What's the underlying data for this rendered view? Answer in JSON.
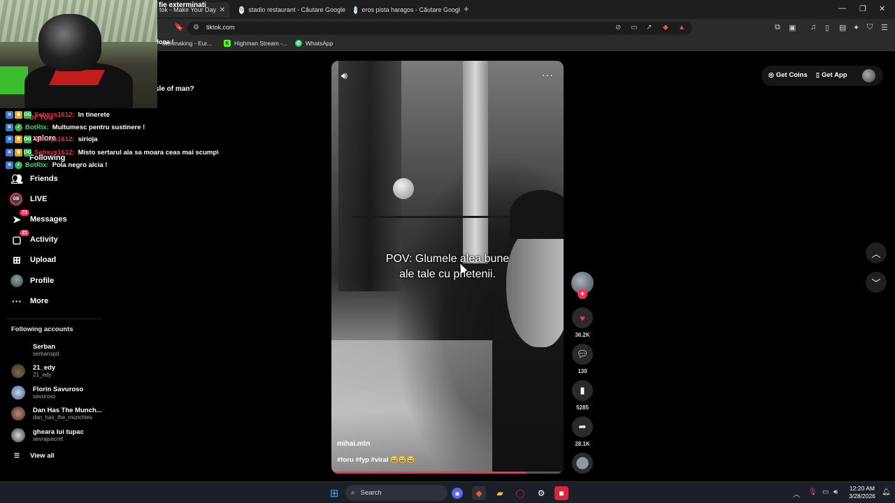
{
  "browser": {
    "tabs": [
      {
        "label": "tok - Make Your Day"
      },
      {
        "label": "stadio restaurant - Căutare Google"
      },
      {
        "label": "eros pista haragos - Căutare Google"
      }
    ],
    "url": "tiktok.com",
    "bookmarks": [
      {
        "label": "atchmaking - Eur..."
      },
      {
        "label": "Highman Stream -..."
      },
      {
        "label": "WhatsApp"
      }
    ]
  },
  "overlay": {
    "top_snippet": "fie exterminati",
    "snippet2": "Jona !",
    "snippet3": "sle of man?"
  },
  "chat": [
    {
      "user": "Sebsys1612:",
      "msg": "In tinerete",
      "color": "#e6334a"
    },
    {
      "user": "BotRix:",
      "msg": "Multumesc pentru sustinere !",
      "color": "#57d357"
    },
    {
      "user": "Sebsys1612:",
      "msg": "sirioja",
      "color": "#e6334a"
    },
    {
      "user": "Sebsys1612:",
      "msg": "Misto sertarul ala sa moara ceas mai scump\\",
      "color": "#e6334a"
    },
    {
      "user": "BotRix:",
      "msg": "Pola negro alcia !",
      "color": "#57d357"
    }
  ],
  "sidebar": {
    "partial_items": [
      "or You",
      "xplore",
      "Following"
    ],
    "items": [
      {
        "label": "Friends",
        "icon": "friends-icon"
      },
      {
        "label": "LIVE",
        "icon": "live-icon"
      },
      {
        "label": "Messages",
        "icon": "messages-icon",
        "badge": "72"
      },
      {
        "label": "Activity",
        "icon": "activity-icon",
        "badge": "21"
      },
      {
        "label": "Upload",
        "icon": "upload-icon"
      },
      {
        "label": "Profile",
        "icon": "profile-icon"
      },
      {
        "label": "More",
        "icon": "more-icon"
      }
    ],
    "following_title": "Following accounts",
    "accounts": [
      {
        "name": "Serban",
        "handle": "serbanspd"
      },
      {
        "name": "21_edy",
        "handle": "21_edy"
      },
      {
        "name": "Florin Savuroso",
        "handle": "savuroso"
      },
      {
        "name": "Dan Has The Munch...",
        "handle": "dan_has_the_munchies"
      },
      {
        "name": "gheara lui tupac",
        "handle": "sevrajsecret"
      }
    ],
    "view_all": "View all"
  },
  "video": {
    "caption_line1": "POV: Glumele alea bune",
    "caption_line2": "ale tale cu prietenii.",
    "author": "mihai.mtn",
    "tags": "#foru #fyp #viral 😅😅😅",
    "progress": 0.84
  },
  "actions": {
    "likes": "36.2K",
    "comments": "130",
    "saves": "5285",
    "shares": "28.1K"
  },
  "topright": {
    "coins": "Get Coins",
    "app": "Get App"
  },
  "taskbar": {
    "search": "Search",
    "time": "12:20 AM",
    "date": "3/28/2026"
  },
  "colors": {
    "accent": "#fe2c55"
  }
}
